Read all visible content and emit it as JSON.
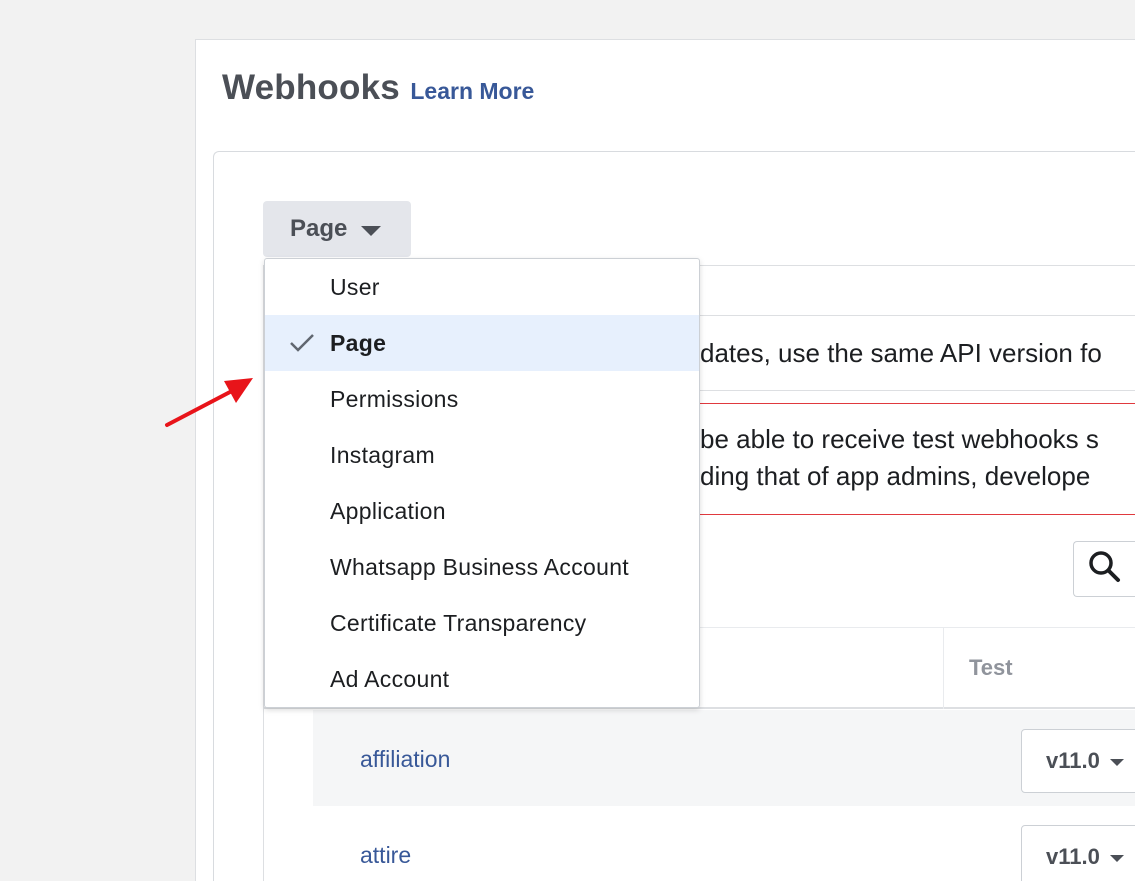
{
  "header": {
    "title": "Webhooks",
    "learn_more": "Learn More"
  },
  "object_selector": {
    "selected": "Page"
  },
  "dropdown": {
    "items": [
      {
        "label": "User",
        "selected": false
      },
      {
        "label": "Page",
        "selected": true
      },
      {
        "label": "Permissions",
        "selected": false
      },
      {
        "label": "Instagram",
        "selected": false
      },
      {
        "label": "Application",
        "selected": false
      },
      {
        "label": "Whatsapp Business Account",
        "selected": false
      },
      {
        "label": "Certificate Transparency",
        "selected": false
      },
      {
        "label": "Ad Account",
        "selected": false
      }
    ]
  },
  "info_text": "dates, use the same API version fo",
  "warning": {
    "line1": "be able to receive test webhooks s",
    "line2": "ding that of app admins, develope"
  },
  "table": {
    "test_header": "Test",
    "rows": [
      {
        "field": "affiliation",
        "version": "v11.0"
      },
      {
        "field": "attire",
        "version": "v11.0"
      }
    ]
  },
  "colors": {
    "link": "#385898",
    "selected_bg": "#e7f0fd",
    "warning_border": "#e0393e",
    "arrow": "#e8141a"
  }
}
